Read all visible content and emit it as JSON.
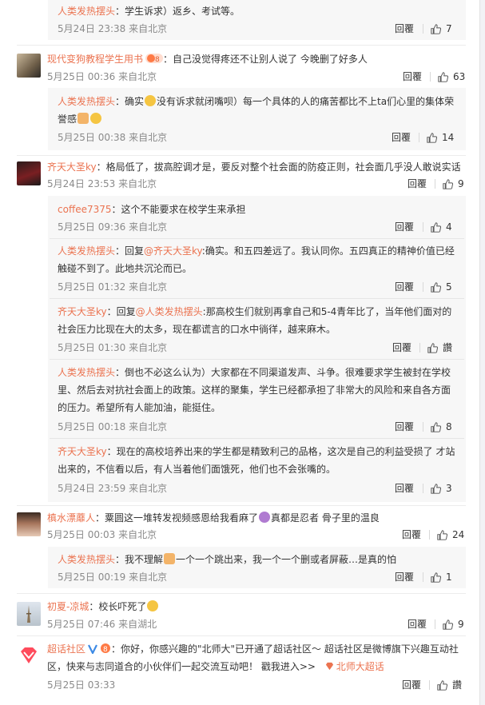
{
  "actions": {
    "reply_label": "回覆",
    "like_zero": "讚"
  },
  "comments": [
    {
      "reply": true,
      "user": "人类发热摆头",
      "lines": [
        "：学生诉求）返乡、考试等。"
      ],
      "time": "5月24日 23:38 来自北京",
      "likes": "7"
    },
    {
      "reply": false,
      "user": "现代变狗教程学生用书",
      "lines": [
        "：自己没觉得疼还不让别人说了 今晚删了好多人"
      ],
      "time": "5月25日 00:36 来自北京",
      "likes": "63"
    },
    {
      "reply": true,
      "user": "人类发热摆头",
      "lines": [
        "：确实",
        "没有诉求就闭嘴呗）每一个具体的人的痛苦都比不上ta们心里的集体荣",
        "誉感"
      ],
      "time": "5月25日 00:38 来自北京",
      "likes": "14"
    },
    {
      "reply": false,
      "user": "齐天大圣ky",
      "lines": [
        "：格局低了，拔高腔调才是，要反对整个社会面的防疫正则，社会面几乎没人敢说实话"
      ],
      "time": "5月24日 23:53 来自北京",
      "likes": "9"
    },
    {
      "reply": true,
      "user": "coffee7375",
      "lines": [
        "：这个不能要求在校学生来承担"
      ],
      "time": "5月25日 09:36 来自北京",
      "likes": "4"
    },
    {
      "reply": true,
      "user": "人类发热摆头",
      "lines": [
        "：回复",
        "@齐天大圣ky",
        ":确实。和五四差远了。我认同你。五四真正的精神价值已经",
        "触碰不到了。此地共沉沦而已。"
      ],
      "time": "5月25日 01:32 来自北京",
      "likes": "5"
    },
    {
      "reply": true,
      "user": "齐天大圣ky",
      "lines": [
        "：回复",
        "@人类发热摆头",
        ":那高校生们就别再拿自己和5-4青年比了，当年他们面对的",
        "社会压力比现在大的太多，现在都谎言的口水中徜徉，越来麻木。"
      ],
      "time": "5月25日 01:30 来自北京",
      "likes": "讚"
    },
    {
      "reply": true,
      "user": "人类发热摆头",
      "lines": [
        "：倒也不必这么认为）大家都在不同渠道发声、斗争。很难要求学生被封在学校",
        "里、然后去对抗社会面上的政策。这样的聚集，学生已经都承担了非常大的风险和来自各方面",
        "的压力。希望所有人能加油，能挺住。"
      ],
      "time": "5月25日 00:18 来自北京",
      "likes": "8"
    },
    {
      "reply": true,
      "user": "齐天大圣ky",
      "lines": [
        "：现在的高校培养出来的学生都是精致利己的品格，这次是自己的利益受损了 才站",
        "出来的，不信看以后，有人当着他们面饿死，他们也不会张嘴的。"
      ],
      "time": "5月24日 23:59 来自北京",
      "likes": "3"
    },
    {
      "reply": false,
      "user": "槙水漂蘼人",
      "lines": [
        "：粟圆这一堆转发视频感恩给我看麻了",
        "真都是忍者 骨子里的温良"
      ],
      "time": "5月25日 00:03 来自北京",
      "likes": "24"
    },
    {
      "reply": true,
      "user": "人类发热摆头",
      "lines": [
        "：我不理解",
        "一个一个跳出来，我一个一个删或者屏蔽…是真的怕"
      ],
      "time": "5月25日 00:19 来自北京",
      "likes": "1"
    },
    {
      "reply": false,
      "user": "初夏-凉城",
      "lines": [
        "：校长吓死了"
      ],
      "time": "5月25日 07:46 来自湖北",
      "likes": "9"
    },
    {
      "reply": false,
      "user": "超话社区",
      "lines": [
        "：你好，你感兴趣的\"北师大\"已开通了超话社区～ 超话社区是微博旗下兴趣互动社",
        "区，快来与志同道合的小伙伴们一起交流互动吧！ 戳我进入>>",
        "北师大超话"
      ],
      "time": "5月25日 03:33",
      "likes": "讚"
    }
  ]
}
